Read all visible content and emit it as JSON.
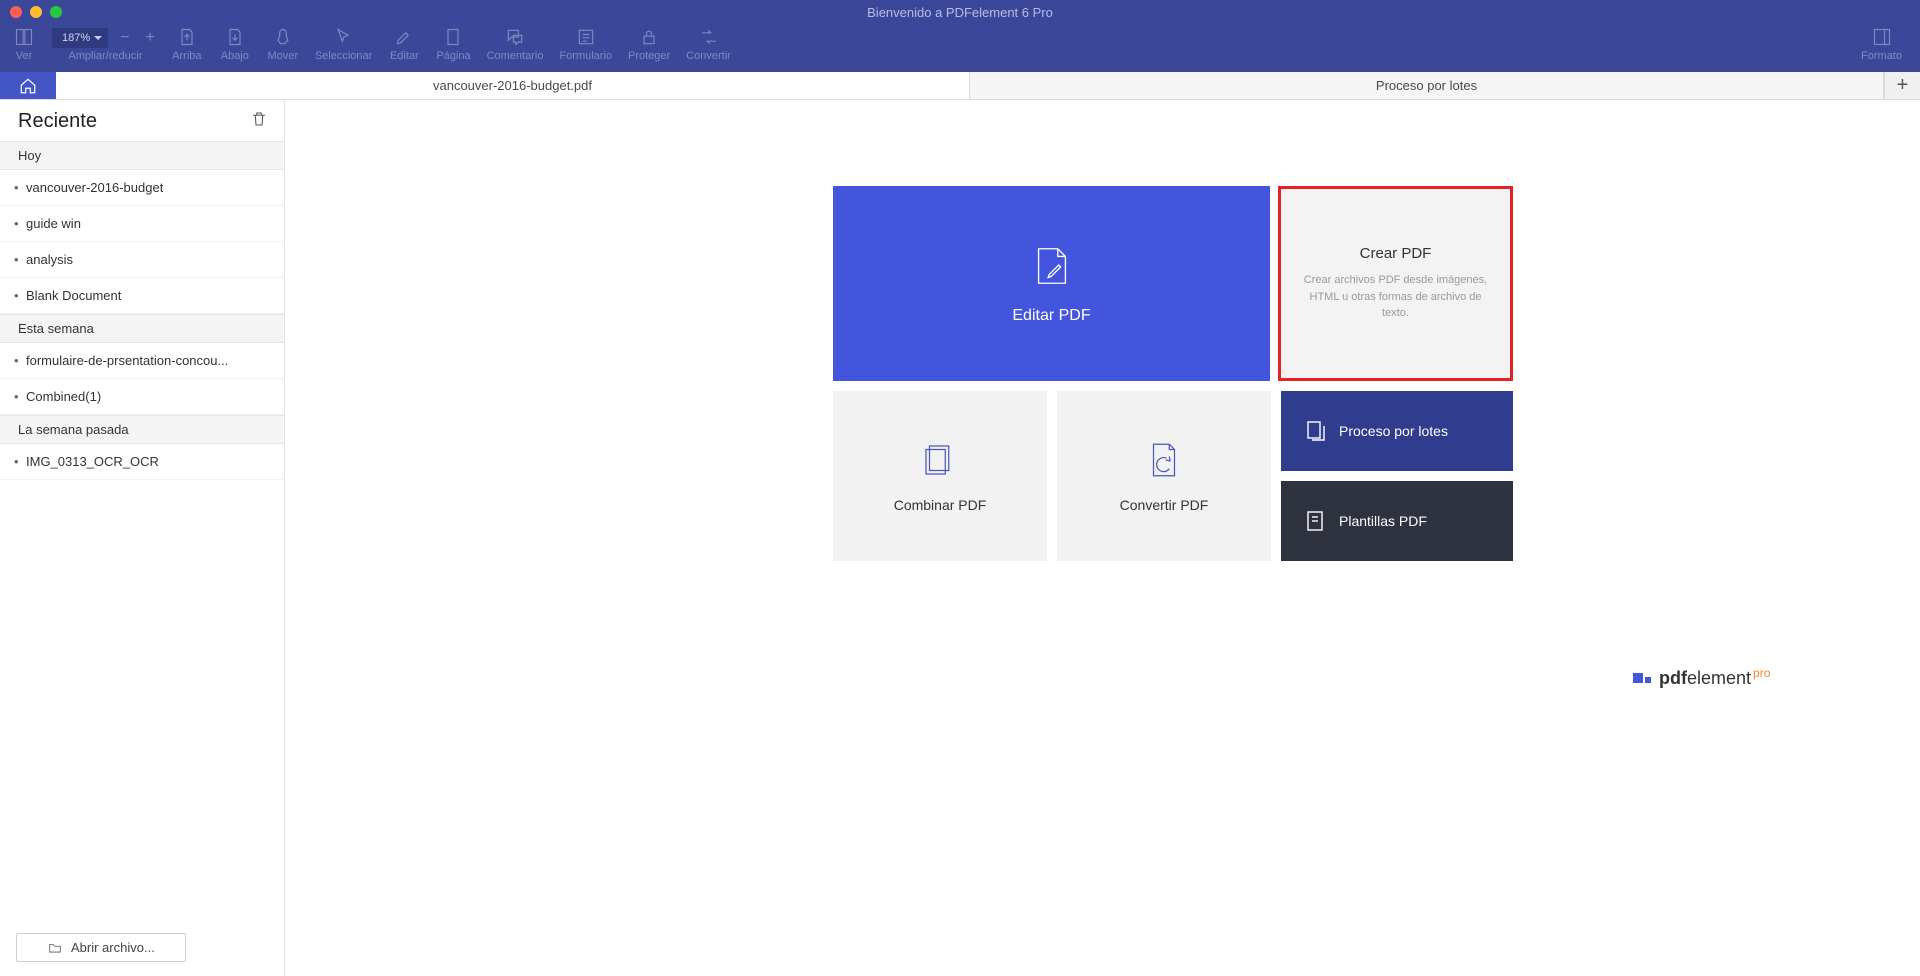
{
  "window": {
    "title": "Bienvenido a PDFelement 6 Pro"
  },
  "toolbar": {
    "ver": "Ver",
    "zoom_label": "Ampliar/reducir",
    "zoom_value": "187%",
    "minus": "−",
    "plus": "+",
    "arriba": "Arriba",
    "abajo": "Abajo",
    "mover": "Mover",
    "seleccionar": "Seleccionar",
    "editar": "Editar",
    "pagina": "Página",
    "comentario": "Comentario",
    "formulario": "Formulario",
    "proteger": "Proteger",
    "convertir": "Convertir",
    "formato": "Formato"
  },
  "tabs": {
    "doc": "vancouver-2016-budget.pdf",
    "batch": "Proceso por lotes"
  },
  "sidebar": {
    "title": "Reciente",
    "sections": [
      {
        "label": "Hoy",
        "items": [
          "vancouver-2016-budget",
          "guide win",
          "analysis",
          "Blank Document"
        ]
      },
      {
        "label": "Esta semana",
        "items": [
          "formulaire-de-prsentation-concou...",
          "Combined(1)"
        ]
      },
      {
        "label": "La semana pasada",
        "items": [
          "IMG_0313_OCR_OCR"
        ]
      }
    ],
    "open_file": "Abrir archivo..."
  },
  "tiles": {
    "edit": "Editar PDF",
    "create_title": "Crear PDF",
    "create_desc": "Crear archivos PDF desde imágenes, HTML u otras formas de archivo de texto.",
    "combine": "Combinar PDF",
    "convert": "Convertir PDF",
    "batch": "Proceso por lotes",
    "templates": "Plantillas PDF"
  },
  "brand": {
    "name1": "pdf",
    "name2": "element",
    "pro": "pro"
  }
}
